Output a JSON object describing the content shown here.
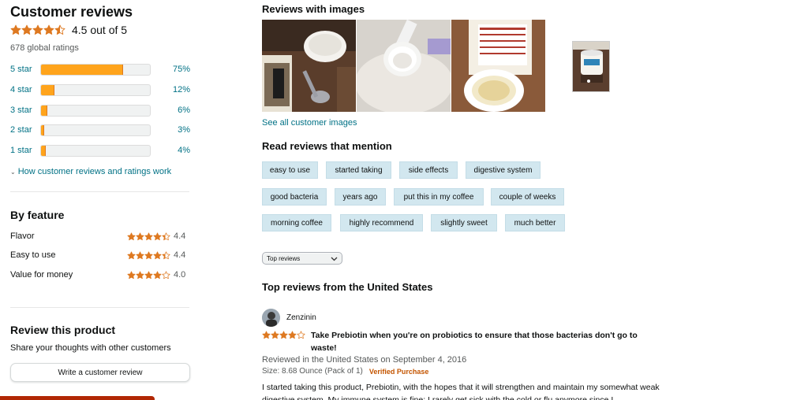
{
  "summary": {
    "title": "Customer reviews",
    "rating": 4.5,
    "rating_text": "4.5 out of 5",
    "global_ratings": "678 global ratings",
    "histogram": [
      {
        "label": "5 star",
        "pct_text": "75%",
        "pct": 75
      },
      {
        "label": "4 star",
        "pct_text": "12%",
        "pct": 12
      },
      {
        "label": "3 star",
        "pct_text": "6%",
        "pct": 6
      },
      {
        "label": "2 star",
        "pct_text": "3%",
        "pct": 3
      },
      {
        "label": "1 star",
        "pct_text": "4%",
        "pct": 4
      }
    ],
    "how_link": "How customer reviews and ratings work"
  },
  "by_feature": {
    "title": "By feature",
    "items": [
      {
        "name": "Flavor",
        "score": "4.4",
        "rating": 4.4
      },
      {
        "name": "Easy to use",
        "score": "4.4",
        "rating": 4.4
      },
      {
        "name": "Value for money",
        "score": "4.0",
        "rating": 4.0
      }
    ]
  },
  "review_product": {
    "title": "Review this product",
    "subtitle": "Share your thoughts with other customers",
    "button": "Write a customer review"
  },
  "images": {
    "title": "Reviews with images",
    "see_all": "See all customer images"
  },
  "mentions": {
    "title": "Read reviews that mention",
    "chips": [
      "easy to use",
      "started taking",
      "side effects",
      "digestive system",
      "good bacteria",
      "years ago",
      "put this in my coffee",
      "couple of weeks",
      "morning coffee",
      "highly recommend",
      "slightly sweet",
      "much better"
    ]
  },
  "sort": {
    "selected": "Top reviews"
  },
  "top_reviews": {
    "title": "Top reviews from the United States",
    "review": {
      "author": "Zenzinin",
      "rating": 4,
      "headline": "Take Prebiotin when you're on probiotics to ensure that those bacterias don't go to waste!",
      "date": "Reviewed in the United States on September 4, 2016",
      "size": "Size: 8.68 Ounce (Pack of 1)",
      "verified": "Verified Purchase",
      "body": "I started taking this product, Prebiotin, with the hopes that it will strengthen and maintain my somewhat weak digestive system. My immune system is fine; I rarely get sick with the cold or flu anymore since I"
    }
  },
  "colors": {
    "star": "#de7921",
    "link": "#007185",
    "bar_fill": "#ffa41c",
    "chip": "#d2e7ef",
    "verified": "#c45500"
  }
}
